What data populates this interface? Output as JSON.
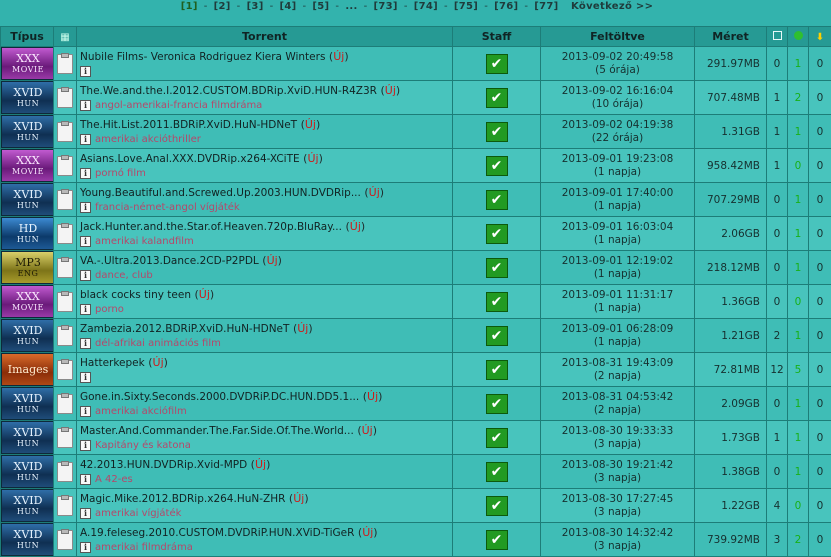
{
  "pager": {
    "pages": [
      "[1]",
      "[2]",
      "[3]",
      "[4]",
      "[5]",
      "...",
      "[73]",
      "[74]",
      "[75]",
      "[76]",
      "[77]"
    ],
    "next": "Következő >>"
  },
  "columns": {
    "type": "Típus",
    "torrent": "Torrent",
    "staff": "Staff",
    "uploaded": "Feltöltve",
    "size": "Méret"
  },
  "uj_label": "Új",
  "rows": [
    {
      "cat_main": "XXX",
      "cat_sub": "MOVIE",
      "cat_style": "xxx",
      "title": "Nubile Films- Veronica Rodriguez Kiera Winters",
      "genre": "",
      "date": "2013-09-02 20:49:58",
      "ago": "(5 órája)",
      "size": "291.97MB",
      "a": "0",
      "b": "1",
      "c": "0"
    },
    {
      "cat_main": "XVID",
      "cat_sub": "HUN",
      "cat_style": "xvid",
      "title": "The.We.and.the.I.2012.CUSTOM.BDRip.XviD.HUN-R4Z3R",
      "genre": "angol-amerikai-francia filmdráma",
      "date": "2013-09-02 16:16:04",
      "ago": "(10 órája)",
      "size": "707.48MB",
      "a": "1",
      "b": "2",
      "c": "0"
    },
    {
      "cat_main": "XVID",
      "cat_sub": "HUN",
      "cat_style": "xvid",
      "title": "The.Hit.List.2011.BDRiP.XviD.HuN-HDNeT",
      "genre": "amerikai akcióthriller",
      "date": "2013-09-02 04:19:38",
      "ago": "(22 órája)",
      "size": "1.31GB",
      "a": "1",
      "b": "1",
      "c": "0"
    },
    {
      "cat_main": "XXX",
      "cat_sub": "MOVIE",
      "cat_style": "xxx",
      "title": "Asians.Love.Anal.XXX.DVDRip.x264-XCiTE",
      "genre": "pornó film",
      "date": "2013-09-01 19:23:08",
      "ago": "(1 napja)",
      "size": "958.42MB",
      "a": "1",
      "b": "0",
      "c": "0"
    },
    {
      "cat_main": "XVID",
      "cat_sub": "HUN",
      "cat_style": "xvid",
      "title": "Young.Beautiful.and.Screwed.Up.2003.HUN.DVDRip...",
      "genre": "francia-német-angol vígjáték",
      "date": "2013-09-01 17:40:00",
      "ago": "(1 napja)",
      "size": "707.29MB",
      "a": "0",
      "b": "1",
      "c": "0"
    },
    {
      "cat_main": "HD",
      "cat_sub": "HUN",
      "cat_style": "hd",
      "title": "Jack.Hunter.and.the.Star.of.Heaven.720p.BluRay...",
      "genre": "amerikai kalandfilm",
      "date": "2013-09-01 16:03:04",
      "ago": "(1 napja)",
      "size": "2.06GB",
      "a": "0",
      "b": "1",
      "c": "0"
    },
    {
      "cat_main": "MP3",
      "cat_sub": "ENG",
      "cat_style": "mp3",
      "title": "VA.-.Ultra.2013.Dance.2CD-P2PDL",
      "genre": "dance, club",
      "date": "2013-09-01 12:19:02",
      "ago": "(1 napja)",
      "size": "218.12MB",
      "a": "0",
      "b": "1",
      "c": "0"
    },
    {
      "cat_main": "XXX",
      "cat_sub": "MOVIE",
      "cat_style": "xxx",
      "title": "black cocks tiny teen",
      "genre": "porno",
      "date": "2013-09-01 11:31:17",
      "ago": "(1 napja)",
      "size": "1.36GB",
      "a": "0",
      "b": "0",
      "c": "0"
    },
    {
      "cat_main": "XVID",
      "cat_sub": "HUN",
      "cat_style": "xvid",
      "title": "Zambezia.2012.BDRiP.XviD.HuN-HDNeT",
      "genre": "dél-afrikai animációs film",
      "date": "2013-09-01 06:28:09",
      "ago": "(1 napja)",
      "size": "1.21GB",
      "a": "2",
      "b": "1",
      "c": "0"
    },
    {
      "cat_main": "Images",
      "cat_sub": "",
      "cat_style": "img",
      "title": "Hatterkepek",
      "genre": "",
      "date": "2013-08-31 19:43:09",
      "ago": "(2 napja)",
      "size": "72.81MB",
      "a": "12",
      "b": "5",
      "c": "0"
    },
    {
      "cat_main": "XVID",
      "cat_sub": "HUN",
      "cat_style": "xvid",
      "title": "Gone.in.Sixty.Seconds.2000.DVDRiP.DC.HUN.DD5.1...",
      "genre": "amerikai akciófilm",
      "date": "2013-08-31 04:53:42",
      "ago": "(2 napja)",
      "size": "2.09GB",
      "a": "0",
      "b": "1",
      "c": "0"
    },
    {
      "cat_main": "XVID",
      "cat_sub": "HUN",
      "cat_style": "xvid",
      "title": "Master.And.Commander.The.Far.Side.Of.The.World...",
      "genre": "Kapitány és katona",
      "date": "2013-08-30 19:33:33",
      "ago": "(3 napja)",
      "size": "1.73GB",
      "a": "1",
      "b": "1",
      "c": "0"
    },
    {
      "cat_main": "XVID",
      "cat_sub": "HUN",
      "cat_style": "xvid",
      "title": "42.2013.HUN.DVDRip.Xvid-MPD",
      "genre": "A 42-es",
      "date": "2013-08-30 19:21:42",
      "ago": "(3 napja)",
      "size": "1.38GB",
      "a": "0",
      "b": "1",
      "c": "0"
    },
    {
      "cat_main": "XVID",
      "cat_sub": "HUN",
      "cat_style": "xvid",
      "title": "Magic.Mike.2012.BDRip.x264.HuN-ZHR",
      "genre": "amerikai vígjáték",
      "date": "2013-08-30 17:27:45",
      "ago": "(3 napja)",
      "size": "1.22GB",
      "a": "4",
      "b": "0",
      "c": "0"
    },
    {
      "cat_main": "XVID",
      "cat_sub": "HUN",
      "cat_style": "xvid",
      "title": "A.19.feleseg.2010.CUSTOM.DVDRiP.HUN.XViD-TiGeR",
      "genre": "amerikai filmdráma",
      "date": "2013-08-30 14:32:42",
      "ago": "(3 napja)",
      "size": "739.92MB",
      "a": "3",
      "b": "2",
      "c": "0"
    }
  ]
}
